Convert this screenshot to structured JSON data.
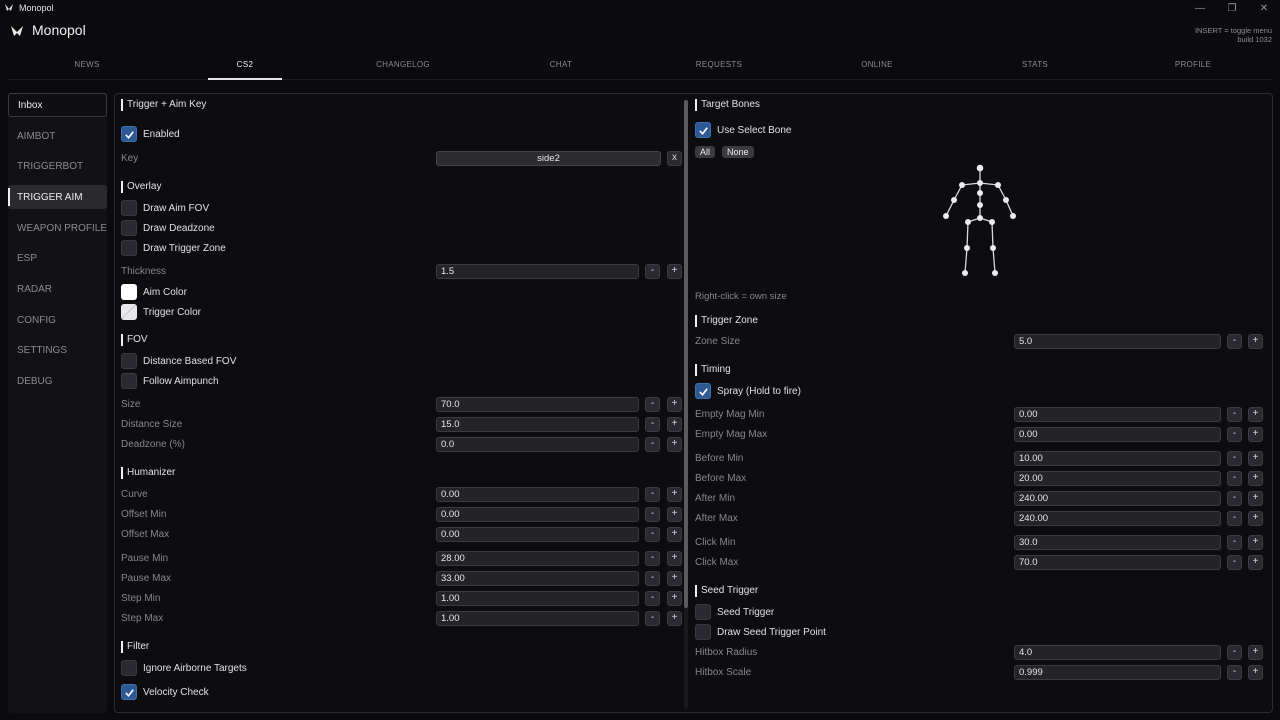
{
  "window": {
    "title": "Monopol",
    "minimize": "—",
    "restore": "❐",
    "close": "✕"
  },
  "header": {
    "app_name": "Monopol",
    "hint": "INSERT = toggle menu",
    "build": "build 1032"
  },
  "nav_tabs": [
    {
      "label": "NEWS"
    },
    {
      "label": "CS2"
    },
    {
      "label": "CHANGELOG"
    },
    {
      "label": "CHAT"
    },
    {
      "label": "REQUESTS"
    },
    {
      "label": "ONLINE"
    },
    {
      "label": "STATS"
    },
    {
      "label": "PROFILE"
    }
  ],
  "sidebar": {
    "items": [
      {
        "label": "Inbox"
      },
      {
        "label": "AIMBOT"
      },
      {
        "label": "TRIGGERBOT"
      },
      {
        "label": "TRIGGER AIM"
      },
      {
        "label": "WEAPON PROFILES"
      },
      {
        "label": "ESP"
      },
      {
        "label": "RADAR"
      },
      {
        "label": "CONFIG"
      },
      {
        "label": "SETTINGS"
      },
      {
        "label": "DEBUG"
      }
    ]
  },
  "left": {
    "trigger_aim_key": {
      "title": "Trigger + Aim Key",
      "enabled_label": "Enabled",
      "enabled": true,
      "key_label": "Key",
      "key_value": "side2",
      "clear_label": "x"
    },
    "overlay": {
      "title": "Overlay",
      "draw_aim_fov": "Draw Aim FOV",
      "draw_deadzone": "Draw Deadzone",
      "draw_trigger_zone": "Draw Trigger Zone",
      "thickness_label": "Thickness",
      "thickness_value": "1.5",
      "aim_color_label": "Aim Color",
      "trigger_color_label": "Trigger Color",
      "aim_color": "#ffffff",
      "trigger_color": "#e8e8ea"
    },
    "fov": {
      "title": "FOV",
      "distance_based_fov": "Distance Based FOV",
      "follow_aimpunch": "Follow Aimpunch",
      "size_label": "Size",
      "size_value": "70.0",
      "distance_size_label": "Distance Size",
      "distance_size_value": "15.0",
      "deadzone_label": "Deadzone (%)",
      "deadzone_value": "0.0"
    },
    "humanizer": {
      "title": "Humanizer",
      "curve_label": "Curve",
      "curve_value": "0.00",
      "offset_min_label": "Offset Min",
      "offset_min_value": "0.00",
      "offset_max_label": "Offset Max",
      "offset_max_value": "0.00",
      "pause_min_label": "Pause Min",
      "pause_min_value": "28.00",
      "pause_max_label": "Pause Max",
      "pause_max_value": "33.00",
      "step_min_label": "Step Min",
      "step_min_value": "1.00",
      "step_max_label": "Step Max",
      "step_max_value": "1.00"
    },
    "filter": {
      "title": "Filter",
      "ignore_airborne": "Ignore Airborne Targets",
      "ignore_airborne_checked": false,
      "velocity_check": "Velocity Check",
      "velocity_check_checked": true
    }
  },
  "right": {
    "target_bones": {
      "title": "Target Bones",
      "use_select_bone": "Use Select Bone",
      "use_select_bone_checked": true,
      "all_label": "All",
      "none_label": "None",
      "note": "Right-click = own size"
    },
    "trigger_zone": {
      "title": "Trigger Zone",
      "zone_size_label": "Zone Size",
      "zone_size_value": "5.0"
    },
    "timing": {
      "title": "Timing",
      "spray_label": "Spray (Hold to fire)",
      "spray_checked": true,
      "empty_mag_min_label": "Empty Mag Min",
      "empty_mag_min_value": "0.00",
      "empty_mag_max_label": "Empty Mag Max",
      "empty_mag_max_value": "0.00",
      "before_min_label": "Before Min",
      "before_min_value": "10.00",
      "before_max_label": "Before Max",
      "before_max_value": "20.00",
      "after_min_label": "After Min",
      "after_min_value": "240.00",
      "after_max_label": "After Max",
      "after_max_value": "240.00",
      "click_min_label": "Click Min",
      "click_min_value": "30.0",
      "click_max_label": "Click Max",
      "click_max_value": "70.0"
    },
    "seed_trigger": {
      "title": "Seed Trigger",
      "seed_trigger_label": "Seed Trigger",
      "draw_seed_point_label": "Draw Seed Trigger Point",
      "hitbox_radius_label": "Hitbox Radius",
      "hitbox_radius_value": "4.0",
      "hitbox_scale_label": "Hitbox Scale",
      "hitbox_scale_value": "0.999"
    }
  },
  "controls": {
    "minus": "-",
    "plus": "+"
  },
  "colors": {
    "accent": "#2d5a94",
    "background": "#0b0b0d",
    "panel_border": "#2c2c31"
  }
}
